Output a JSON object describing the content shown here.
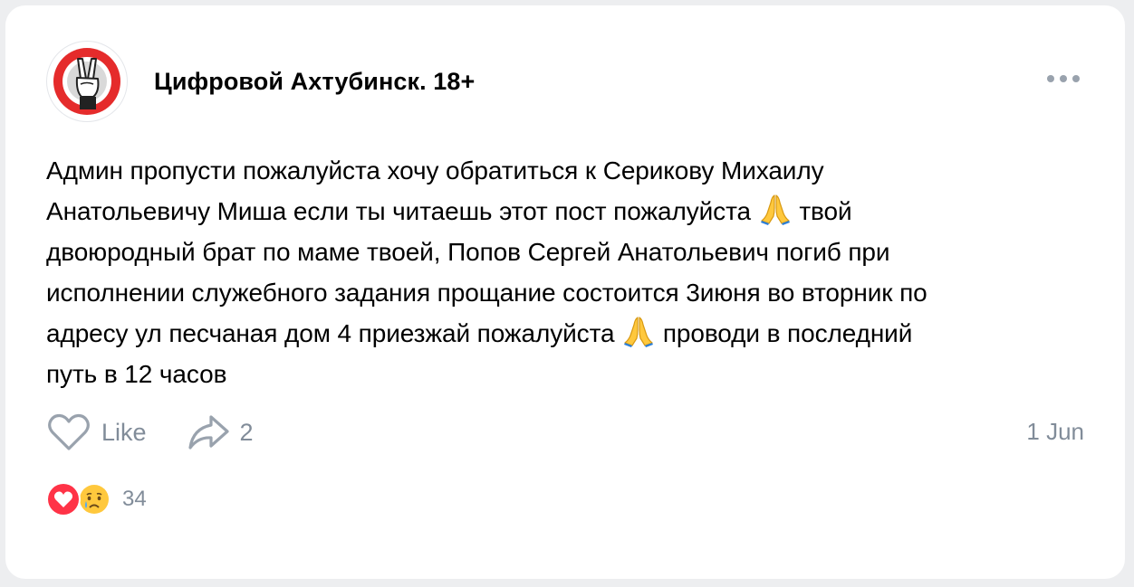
{
  "group": {
    "name": "Цифровой Ахтубинск. 18+",
    "avatar_icon": "peace-hand-logo"
  },
  "post": {
    "lines": [
      "Админ пропусти пожалуйста хочу обратиться к Серикову Михаилу",
      "Анатольевичу Миша если ты читаешь этот пост пожалуйста ",
      " твой",
      "двоюродный брат по маме твоей, Попов Сергей Анатольевич погиб при",
      "исполнении служебного задания прощание состоится 3июня во вторник по",
      "адресу ул песчаная дом 4 приезжай пожалуйста ",
      " проводи в последний",
      "путь в 12 часов"
    ],
    "emoji_icon": "folded-hands-icon"
  },
  "actions": {
    "like_label": "Like",
    "share_count": "2",
    "date": "1 Jun"
  },
  "reactions": {
    "icons": [
      "red-heart-icon",
      "crying-face-icon"
    ],
    "count": "34"
  },
  "colors": {
    "background": "#edeef0",
    "card": "#ffffff",
    "muted_text": "#818c99",
    "icon_gray": "#99a2ad",
    "logo_red": "#e52b2b",
    "heart_red": "#ff3347",
    "emoji_yellow": "#ffc83d"
  }
}
